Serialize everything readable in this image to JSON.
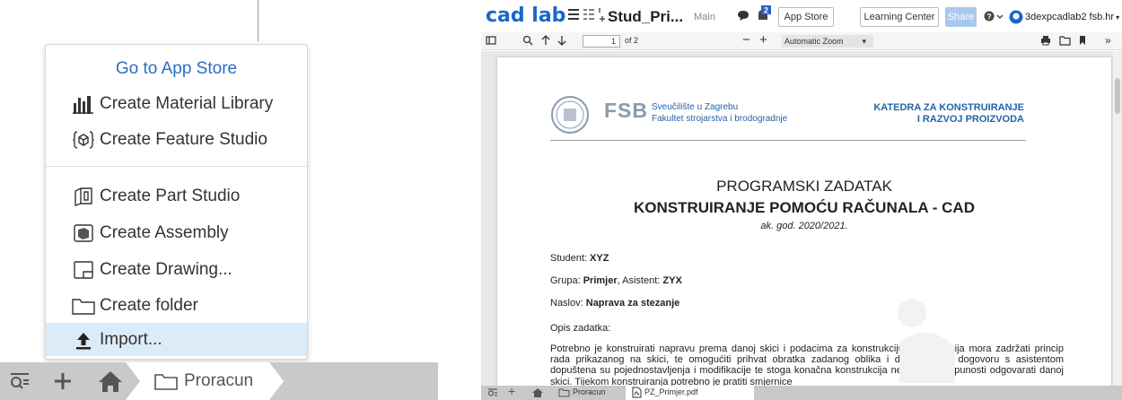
{
  "menu": {
    "header": "Go to App Store",
    "items": [
      {
        "label": "Create Material Library",
        "icon": "material-library-icon"
      },
      {
        "label": "Create Feature Studio",
        "icon": "feature-studio-icon"
      },
      {
        "label": "Create Part Studio",
        "icon": "part-studio-icon"
      },
      {
        "label": "Create Assembly",
        "icon": "assembly-icon"
      },
      {
        "label": "Create Drawing...",
        "icon": "drawing-icon"
      },
      {
        "label": "Create folder",
        "icon": "folder-icon"
      },
      {
        "label": "Import...",
        "icon": "import-icon"
      }
    ]
  },
  "left_breadcrumb": {
    "folder": "Proracun"
  },
  "topbar": {
    "logo": "cad lab",
    "doc_name": "Stud_Pri...",
    "branch": "Main",
    "notification_count": "2",
    "app_store": "App Store",
    "learning_center": "Learning Center",
    "share": "Share",
    "user": "3dexpcadlab2 fsb.hr"
  },
  "pdf_toolbar": {
    "page": "1",
    "of_pages": "of 2",
    "zoom": "Automatic Zoom"
  },
  "document": {
    "uni_line1": "Sveučilište u Zagrebu",
    "uni_line2": "Fakultet strojarstva i brodogradnje",
    "fsb": "FSB",
    "katedra_line1": "KATEDRA ZA KONSTRUIRANJE",
    "katedra_line2": "I RAZVOJ PROIZVODA",
    "title1": "PROGRAMSKI ZADATAK",
    "title2": "KONSTRUIRANJE POMOĆU RAČUNALA - CAD",
    "year": "ak. god. 2020/2021.",
    "student_label": "Student:",
    "student_value": "XYZ",
    "grupa_label": "Grupa:",
    "grupa_value": "Primjer",
    "asistent_label": ", Asistent:",
    "asistent_value": "ZYX",
    "naslov_label": "Naslov:",
    "naslov_value": "Naprava za stezanje",
    "opis": "Opis zadatka:",
    "paragraph": "Potrebno je konstruirati napravu prema danoj skici i podacima za konstrukciju. Konstrukcija mora zadržati princip rada prikazanog na skici, te omogućiti prihvat obratka zadanog oblika i dimenzija. U dogovoru s asistentom dopuštena su pojednostavljenja i modifikacije te stoga konačna konstrukcija ne mora u potpunosti odgovarati danoj skici. Tijekom konstruiranja potrebno je pratiti smjernice"
  },
  "right_breadcrumb": {
    "folder": "Proracun",
    "file": "PZ_Primjer.pdf"
  }
}
